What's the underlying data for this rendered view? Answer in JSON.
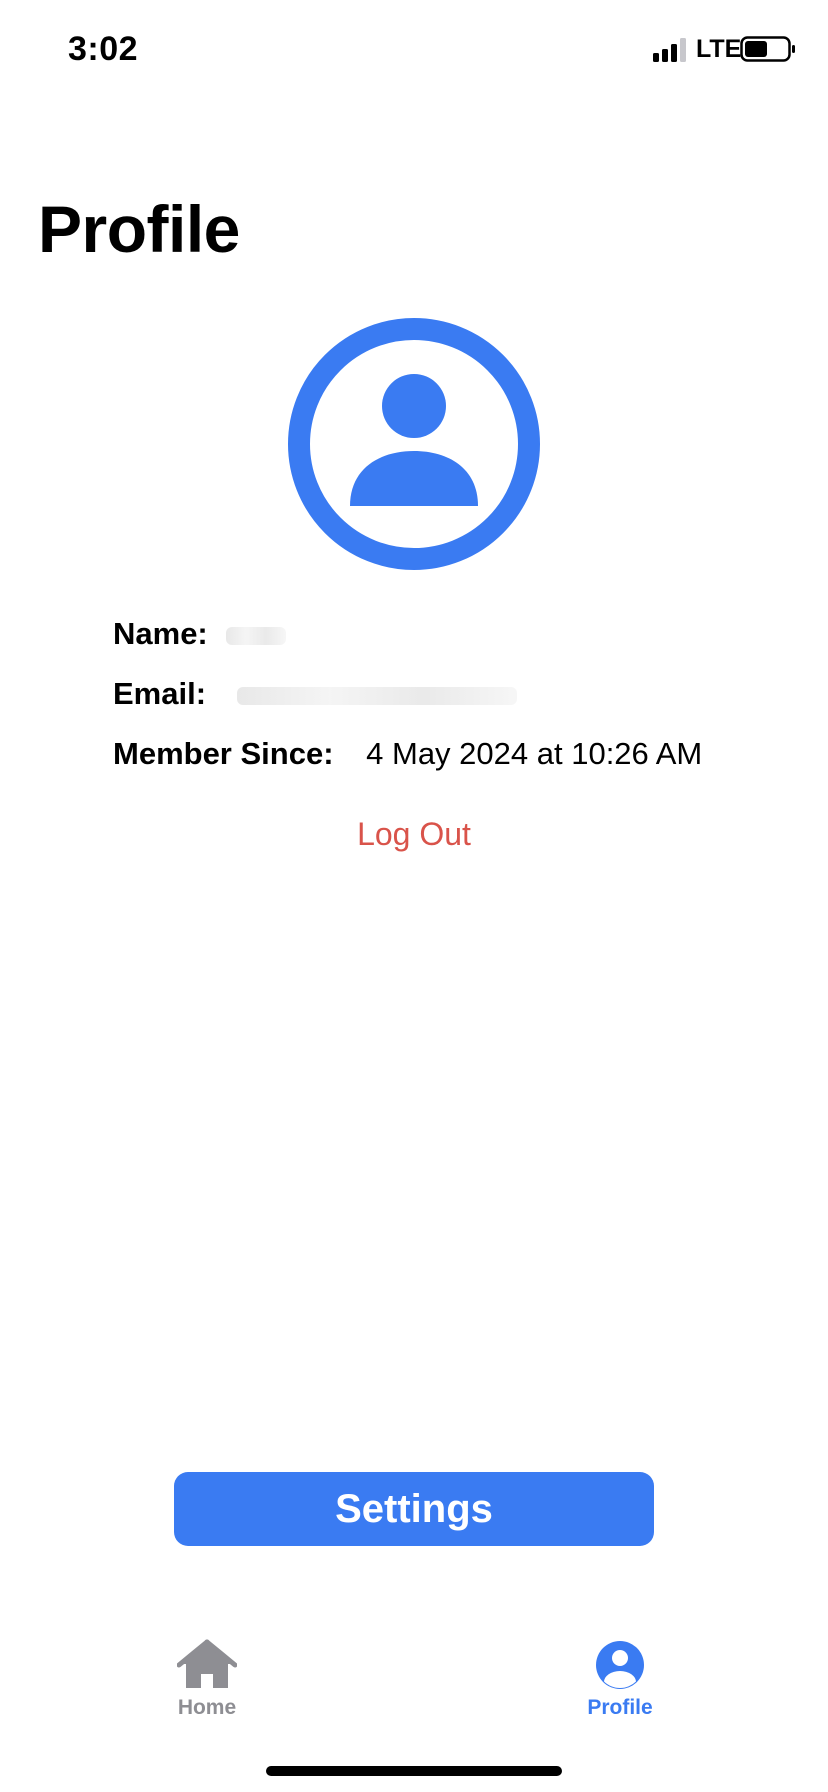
{
  "status_bar": {
    "time": "3:02",
    "network": "LTE",
    "signal_icon": "cellular-signal-icon",
    "battery_icon": "battery-icon"
  },
  "page": {
    "title": "Profile"
  },
  "avatar": {
    "icon": "person-circle-icon",
    "color": "#3a7bf2"
  },
  "info": {
    "name_label": "Name:",
    "email_label": "Email:",
    "member_since_label": "Member Since:",
    "member_since_value": "4 May 2024 at 10:26 AM"
  },
  "actions": {
    "logout_label": "Log Out",
    "logout_color": "#d9534a",
    "settings_label": "Settings",
    "settings_color": "#3a7bf2"
  },
  "tab_bar": {
    "tabs": [
      {
        "label": "Home",
        "icon": "house-icon",
        "active": false
      },
      {
        "label": "Profile",
        "icon": "person-circle-icon",
        "active": true
      }
    ],
    "active_color": "#3a7bf2",
    "inactive_color": "#8e8e93"
  }
}
